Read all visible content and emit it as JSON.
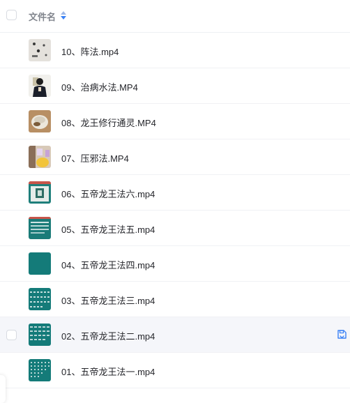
{
  "header": {
    "name_column": "文件名",
    "sort_icon": "sort-icon"
  },
  "files": [
    {
      "name": "10、阵法.mp4"
    },
    {
      "name": "09、治病水法.MP4"
    },
    {
      "name": "08、龙王修行通灵.MP4"
    },
    {
      "name": "07、压邪法.MP4"
    },
    {
      "name": "06、五帝龙王法六.mp4"
    },
    {
      "name": "05、五帝龙王法五.mp4"
    },
    {
      "name": "04、五帝龙王法四.mp4"
    },
    {
      "name": "03、五帝龙王法三.mp4"
    },
    {
      "name": "02、五帝龙王法二.mp4"
    },
    {
      "name": "01、五帝龙王法一.mp4"
    }
  ],
  "hovered_row_action_icon": "save-to-drive-icon",
  "colors": {
    "accent": "#3b82f6",
    "hover_row": "#f5f6fa",
    "teal_thumb": "#147b79"
  }
}
